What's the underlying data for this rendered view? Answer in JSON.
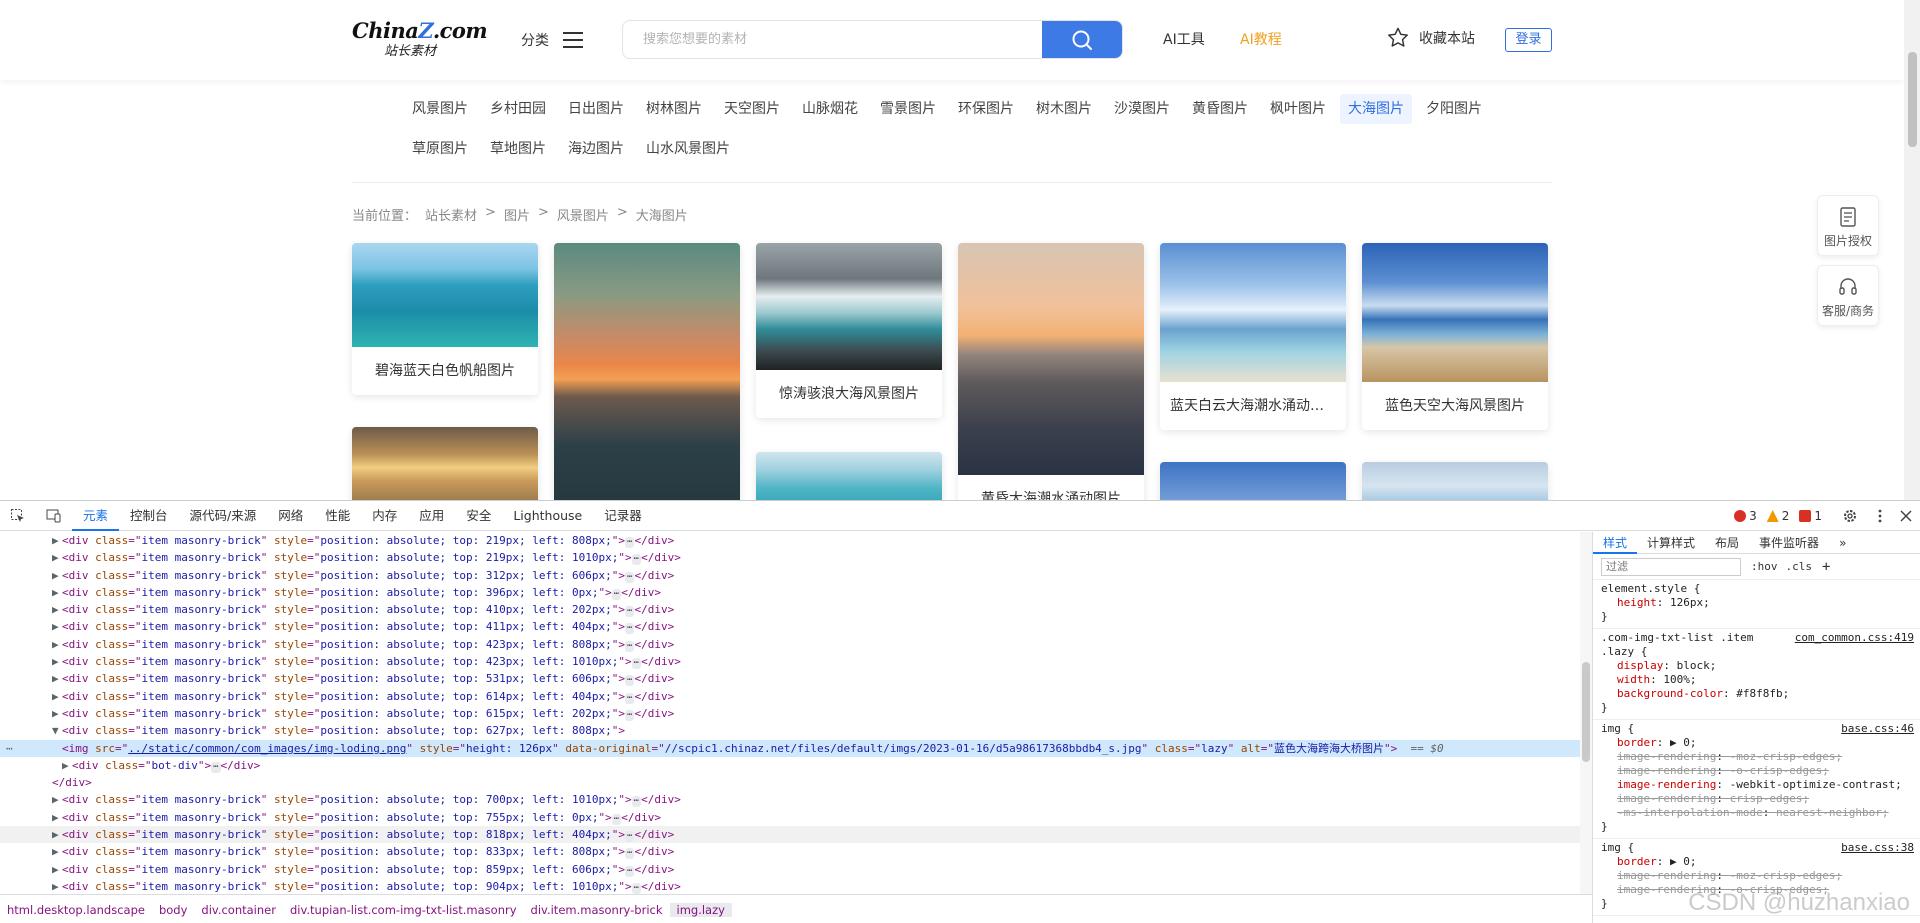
{
  "header": {
    "logo_main": "China",
    "logo_z": "Z",
    "logo_tld": ".com",
    "logo_sub": "站长素材",
    "category_label": "分类",
    "search_placeholder": "搜索您想要的素材",
    "nav": [
      {
        "label": "AI工具",
        "color": "#333333"
      },
      {
        "label": "AI教程",
        "color": "#f0a020"
      }
    ],
    "favorite_label": "收藏本站",
    "login_label": "登录"
  },
  "tags": [
    {
      "label": "风景图片",
      "row": 0
    },
    {
      "label": "乡村田园",
      "row": 0
    },
    {
      "label": "日出图片",
      "row": 0
    },
    {
      "label": "树林图片",
      "row": 0
    },
    {
      "label": "天空图片",
      "row": 0
    },
    {
      "label": "山脉烟花",
      "row": 0
    },
    {
      "label": "雪景图片",
      "row": 0
    },
    {
      "label": "环保图片",
      "row": 0
    },
    {
      "label": "树木图片",
      "row": 0
    },
    {
      "label": "沙漠图片",
      "row": 0
    },
    {
      "label": "黄昏图片",
      "row": 0
    },
    {
      "label": "枫叶图片",
      "row": 0
    },
    {
      "label": "大海图片",
      "row": 0,
      "active": true
    },
    {
      "label": "夕阳图片",
      "row": 0
    },
    {
      "label": "草原图片",
      "row": 1
    },
    {
      "label": "草地图片",
      "row": 1
    },
    {
      "label": "海边图片",
      "row": 1
    },
    {
      "label": "山水风景图片",
      "row": 1
    }
  ],
  "breadcrumb": {
    "prefix": "当前位置：",
    "items": [
      "站长素材",
      "图片",
      "风景图片",
      "大海图片"
    ],
    "sep": ">"
  },
  "cards": [
    {
      "caption": "碧海蓝天白色帆船图片",
      "scene": "sea-sailboat"
    },
    {
      "caption": "",
      "scene": "sunset-sea-tall"
    },
    {
      "caption": "惊涛骇浪大海风景图片",
      "scene": "storm-wave"
    },
    {
      "caption": "黄昏大海潮水涌动图片",
      "scene": "dusk-tide"
    },
    {
      "caption": "蓝天白云大海潮水涌动图...",
      "scene": "blue-sky-island"
    },
    {
      "caption": "蓝色天空大海风景图片",
      "scene": "blue-beach"
    },
    {
      "caption": "",
      "scene": "sunrise-sea"
    },
    {
      "caption": "",
      "scene": "turquoise-sea"
    },
    {
      "caption": "",
      "scene": "sky-partial"
    },
    {
      "caption": "",
      "scene": "iceberg"
    }
  ],
  "side_widgets": [
    {
      "label": "图片授权",
      "icon": "document-icon"
    },
    {
      "label": "客服/商务",
      "icon": "headset-icon"
    }
  ],
  "devtools": {
    "tabs": [
      "元素",
      "控制台",
      "源代码/来源",
      "网络",
      "性能",
      "内存",
      "应用",
      "安全",
      "Lighthouse",
      "记录器"
    ],
    "active_tab": "元素",
    "errors": "3",
    "warnings": "2",
    "issues": "1",
    "element_lines": [
      {
        "indent": 1,
        "type": "div",
        "top": "219",
        "left": "808"
      },
      {
        "indent": 1,
        "type": "div",
        "top": "219",
        "left": "1010"
      },
      {
        "indent": 1,
        "type": "div",
        "top": "312",
        "left": "606"
      },
      {
        "indent": 1,
        "type": "div",
        "top": "396",
        "left": "0"
      },
      {
        "indent": 1,
        "type": "div",
        "top": "410",
        "left": "202"
      },
      {
        "indent": 1,
        "type": "div",
        "top": "411",
        "left": "404"
      },
      {
        "indent": 1,
        "type": "div",
        "top": "423",
        "left": "808"
      },
      {
        "indent": 1,
        "type": "div",
        "top": "423",
        "left": "1010"
      },
      {
        "indent": 1,
        "type": "div",
        "top": "531",
        "left": "606"
      },
      {
        "indent": 1,
        "type": "div",
        "top": "614",
        "left": "404"
      },
      {
        "indent": 1,
        "type": "div",
        "top": "615",
        "left": "202"
      },
      {
        "indent": 1,
        "type": "div-open",
        "top": "627",
        "left": "808"
      },
      {
        "indent": 2,
        "type": "img",
        "src": "../static/common/com_images/img-loding.png",
        "style": "height: 126px",
        "data_original": "//scpic1.chinaz.net/files/default/imgs/2023-01-16/d5a98617368bbdb4_s.jpg",
        "class": "lazy",
        "alt": "蓝色大海跨海大桥图片",
        "suffix": "== $0"
      },
      {
        "indent": 2,
        "type": "botdiv",
        "class": "bot-div"
      },
      {
        "indent": 1,
        "type": "close"
      },
      {
        "indent": 1,
        "type": "div",
        "top": "700",
        "left": "1010"
      },
      {
        "indent": 1,
        "type": "div",
        "top": "755",
        "left": "0"
      },
      {
        "indent": 1,
        "type": "div",
        "top": "818",
        "left": "404"
      },
      {
        "indent": 1,
        "type": "div",
        "top": "833",
        "left": "808"
      },
      {
        "indent": 1,
        "type": "div",
        "top": "859",
        "left": "606"
      },
      {
        "indent": 1,
        "type": "div",
        "top": "904",
        "left": "1010"
      }
    ],
    "item_class": "item masonry-brick",
    "styles_tabs": [
      "样式",
      "计算样式",
      "布局",
      "事件监听器"
    ],
    "filter_placeholder": "过滤",
    "filter_hov": ":hov",
    "filter_cls": ".cls",
    "rules": [
      {
        "selector": "element.style {",
        "source": "",
        "props": [
          {
            "name": "height",
            "value": "126px;",
            "strike": false
          }
        ]
      },
      {
        "selector": ".com-img-txt-list .item .lazy {",
        "source": "com_common.css:419",
        "props": [
          {
            "name": "display",
            "value": "block;",
            "strike": false
          },
          {
            "name": "width",
            "value": "100%;",
            "strike": false
          },
          {
            "name": "background-color",
            "value": "#f8f8fb;",
            "strike": false
          }
        ]
      },
      {
        "selector": "img {",
        "source": "base.css:46",
        "props": [
          {
            "name": "border",
            "value": "▶ 0;",
            "strike": false
          },
          {
            "name": "image-rendering",
            "value": "-moz-crisp-edges;",
            "strike": true
          },
          {
            "name": "image-rendering",
            "value": "-o-crisp-edges;",
            "strike": true
          },
          {
            "name": "image-rendering",
            "value": "-webkit-optimize-contrast;",
            "strike": false
          },
          {
            "name": "image-rendering",
            "value": "crisp-edges;",
            "strike": true
          },
          {
            "name": "-ms-interpolation-mode",
            "value": "nearest-neighbor;",
            "strike": true
          }
        ]
      },
      {
        "selector": "img {",
        "source": "base.css:38",
        "props": [
          {
            "name": "border",
            "value": "▶ 0;",
            "strike": false
          },
          {
            "name": "image-rendering",
            "value": "-moz-crisp-edges;",
            "strike": true
          },
          {
            "name": "image-rendering",
            "value": "-o-crisp-edges;",
            "strike": true
          }
        ]
      }
    ],
    "breadcrumbs": [
      "html.desktop.landscape",
      "body",
      "div.container",
      "div.tupian-list.com-img-txt-list.masonry",
      "div.item.masonry-brick",
      "img.lazy"
    ],
    "watermark": "CSDN @huzhanxiao"
  }
}
